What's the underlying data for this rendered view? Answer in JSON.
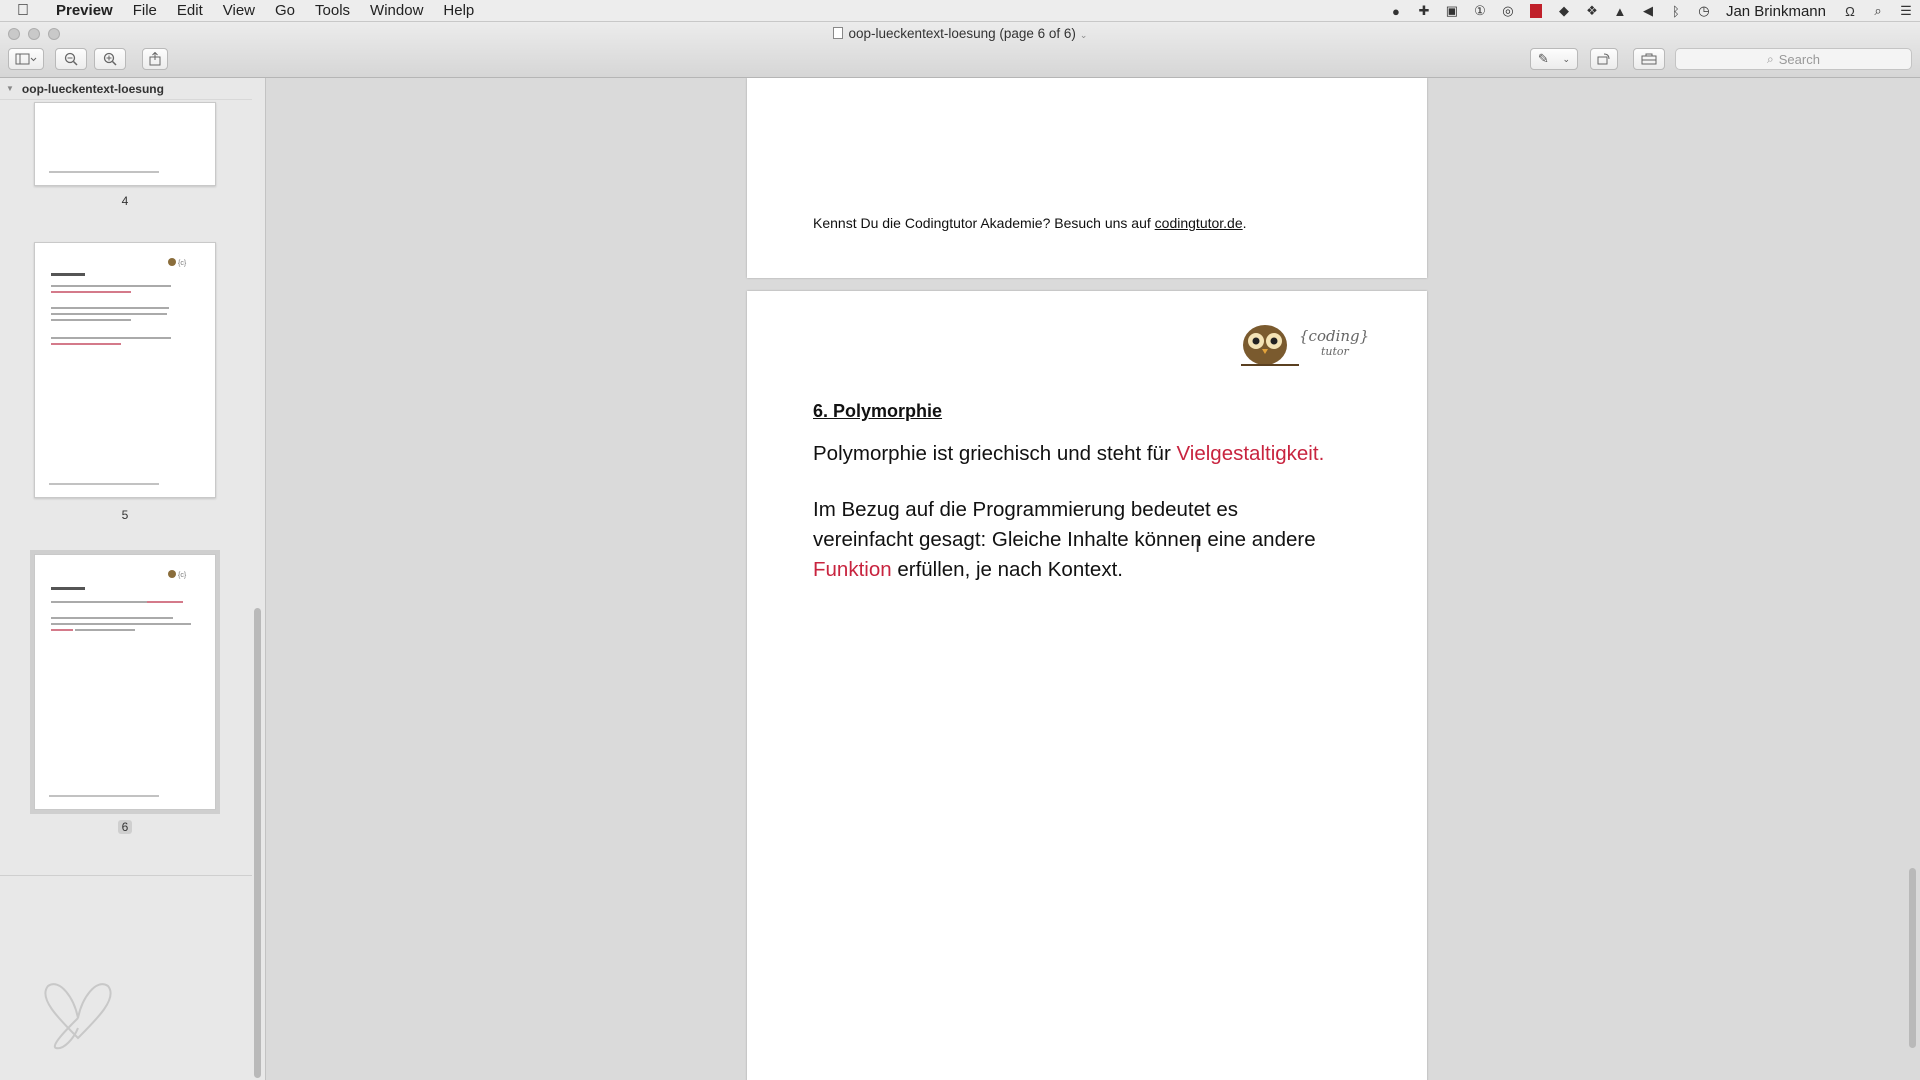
{
  "menubar": {
    "app": "Preview",
    "items": [
      "File",
      "Edit",
      "View",
      "Go",
      "Tools",
      "Window",
      "Help"
    ],
    "user": "Jan Brinkmann"
  },
  "window": {
    "title": "oop-lueckentext-loesung (page 6 of 6)",
    "search_placeholder": "Search"
  },
  "sidebar": {
    "document_name": "oop-lueckentext-loesung",
    "thumbnails": [
      {
        "label": "4"
      },
      {
        "label": "5"
      },
      {
        "label": "6",
        "selected": true
      }
    ]
  },
  "page_prev": {
    "footer_text": "Kennst Du die Codingtutor Akademie? Besuch uns auf ",
    "footer_link": "codingtutor.de",
    "footer_end": "."
  },
  "page_current": {
    "logo_text_1": "{coding}",
    "logo_text_2": "tutor",
    "heading": "6. Polymorphie",
    "para1_text": "Polymorphie ist griechisch und steht für ",
    "para1_red": "Vielgestaltigkeit",
    "para1_end": ".",
    "para2_line1": "Im Bezug auf die Programmierung bedeutet es",
    "para2_line2": "vereinfacht gesagt: Gleiche Inhalte können eine andere",
    "para2_red": "Funktion",
    "para2_end": " erfüllen, je nach Kontext."
  }
}
